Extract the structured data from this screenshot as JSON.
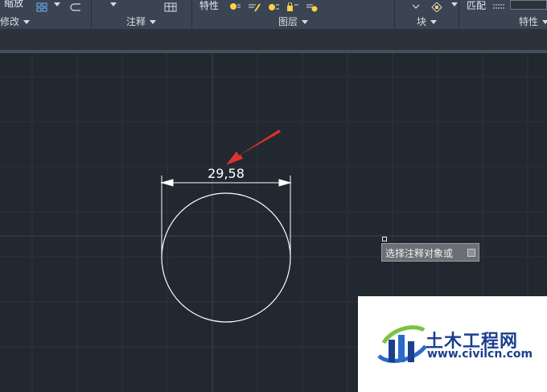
{
  "ribbon": {
    "top_items": {
      "zoom": "缩放",
      "properties": "特性",
      "match": "匹配"
    },
    "panels": {
      "modify": "修改",
      "annotation": "注释",
      "layers": "图层",
      "block": "块",
      "properties": "特性"
    }
  },
  "drawing": {
    "dimension_text": "29,58"
  },
  "tooltip": {
    "prompt": "选择注释对象或"
  },
  "watermark": {
    "name": "土木工程网",
    "url": "www.civilcn.com"
  },
  "colors": {
    "canvas_bg": "#212830",
    "ribbon_bg": "#3b4453",
    "arrow": "#e0312b",
    "geometry": "#ffffff",
    "watermark_blue": "#1a3f8f",
    "watermark_green": "#7cc242"
  }
}
